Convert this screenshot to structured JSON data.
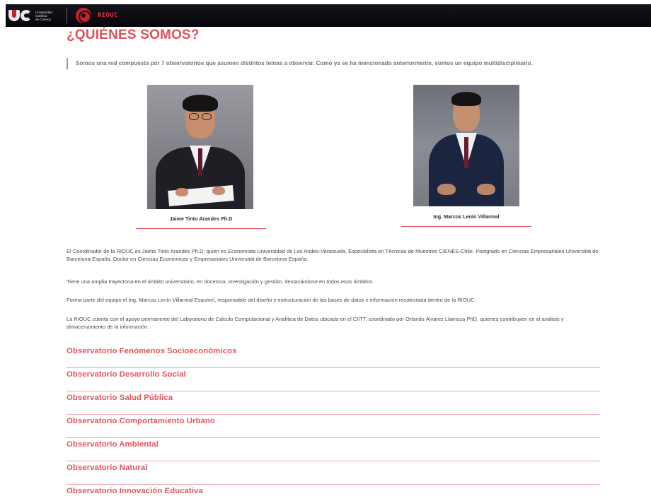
{
  "header": {
    "university_lines": [
      "Universidad",
      "Católica",
      "de Cuenca"
    ],
    "brand": "RIOUC"
  },
  "page": {
    "title": "¿QUIÉNES SOMOS?",
    "intro": "Somos una red compuesta por 7 observatorios que asumen distintos temas a observar. Como ya se ha mencionado anteriormente, somos un equipo multidisciplinario."
  },
  "team": [
    {
      "name": "Jaime Tinto Arandes Ph.D"
    },
    {
      "name": "Ing. Marcos Lenín Villarreal"
    }
  ],
  "paragraphs": [
    "El Coordinador de la RIOUC es Jaime Tinto Arandes Ph.D; quien es Economista Universidad de Los Andes-Venezuela, Especialista en Técnicas de Muestreo CIENES-Chile, Postgrado en Ciencias Empresariales Universitat de Barcelona-España, Doctor en Ciencias Económicas y Empresariales Universitat de Barcelona España.",
    "Tiene una amplia trayectoria en el ámbito universitario, en docencia, investigación y gestión, destacándose en todos esos ámbitos.",
    "Forma parte del equipo el Ing. Marcos Lenín Villarreal Esquivel, responsable del diseño y estructuración de las bases de datos e información recolectada dentro de la RIOUC.",
    "La RIOUC cuenta con el apoyo permanente del Laboratorio de Calculo Computacional y Analítica de Datos ubicado en el CIITT, coordinado por Orlando Álvarez Llamoza PhD, quienes contribuyen en el análisis y almacenamiento de la información."
  ],
  "observatorios": [
    "Observatorio Fenómenos Socioeconómicos",
    "Observatorio Desarrollo Social",
    "Observatorio Salud Pública",
    "Observatorio Comportamiento Urbano",
    "Observatorio Ambiental",
    "Observatorio Natural",
    "Observatorio Innovación Educativa"
  ],
  "colors": {
    "accent": "#e35058",
    "header_bg": "#05050a",
    "brand_red": "#c8202d"
  }
}
